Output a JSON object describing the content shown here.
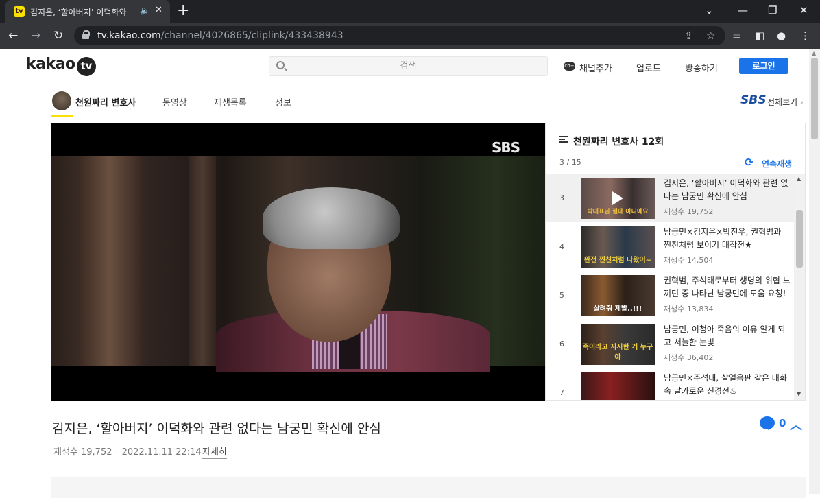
{
  "browser": {
    "tab_title": "김지은, ‘할아버지’ 이덕화와",
    "tab_favicon": "kakao-tv-favicon",
    "url_domain": "tv.kakao.com",
    "url_path": "/channel/4026865/cliplink/433438943"
  },
  "header": {
    "logo_text": "kakao",
    "logo_tv": "tv",
    "search_placeholder": "검색",
    "add_channel": "채널추가",
    "upload": "업로드",
    "broadcast": "방송하기",
    "login": "로그인"
  },
  "subnav": {
    "channel_name": "천원짜리 변호사",
    "tabs": [
      "동영상",
      "재생목록",
      "정보"
    ],
    "broadcaster": "SBS",
    "view_all": "전체보기"
  },
  "player": {
    "watermark": "SBS"
  },
  "playlist": {
    "title": "천원짜리 변호사 12회",
    "position": "3 / 15",
    "autoplay": "연속재생",
    "items": [
      {
        "num": "3",
        "title": "김지은, ‘할아버지’ 이덕화와 관련 없다는 남궁민 확신에 안심",
        "views": "재생수 19,752",
        "caption": "박대표님 절대 아니에요",
        "current": true
      },
      {
        "num": "4",
        "title": "남궁민×김지은×박진우, 권혁범과 찐친처럼 보이기 대작전★",
        "views": "재생수 14,504",
        "caption": "완전 찐친처럼 나왔어~"
      },
      {
        "num": "5",
        "title": "권혁범, 주석태로부터 생명의 위협 느끼던 중 나타난 남궁민에 도움 요청!",
        "views": "재생수 13,834",
        "caption": "살려줘 제발..!!!"
      },
      {
        "num": "6",
        "title": "남궁민, 이청아 죽음의 이유 알게 되고 서늘한 눈빛",
        "views": "재생수 36,402",
        "caption": "죽이라고 지시한 거 누구야"
      },
      {
        "num": "7",
        "title": "남궁민×주석태, 살얼음판 같은 대화 속 날카로운 신경전♨",
        "views": "",
        "caption": ""
      }
    ]
  },
  "video": {
    "title": "김지은, ‘할아버지’ 이덕화와 관련 없다는 남궁민 확신에 안심",
    "views": "재생수 19,752",
    "date": "2022.11.11 22:14",
    "detail": "자세히",
    "comment_count": "0"
  },
  "colors": {
    "accent": "#1a73e8",
    "kakao_yellow": "#fae100",
    "sbs_blue": "#1a4d9e"
  }
}
